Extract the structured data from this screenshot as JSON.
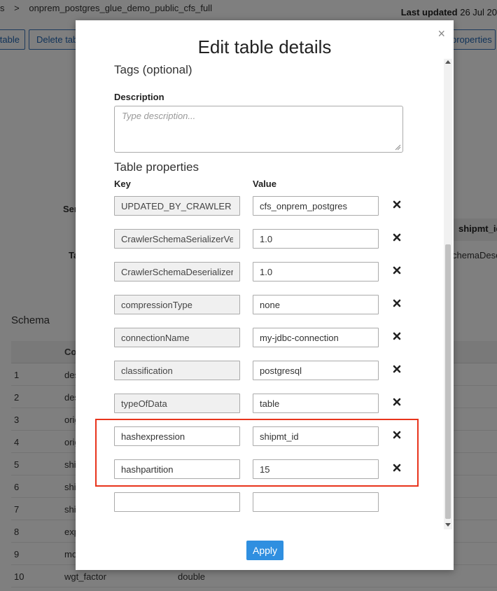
{
  "background": {
    "breadcrumb": {
      "separator": ">",
      "name": "onprem_postgres_glue_demo_public_cfs_full",
      "prefix": "s"
    },
    "last_updated": {
      "label": "Last updated",
      "value": "26 Jul 20"
    },
    "buttons": {
      "edit_table": "table",
      "delete_table": "Delete tab",
      "edit_properties": "properties"
    },
    "labels": {
      "serde": "Ser",
      "table": "Ta",
      "shipmt_header": "shipmt_id",
      "serde_value": "chemaDese"
    },
    "schema": {
      "title": "Schema",
      "column_header": "Co",
      "rows": [
        {
          "index": "1",
          "column": "des",
          "type": ""
        },
        {
          "index": "2",
          "column": "des",
          "type": ""
        },
        {
          "index": "3",
          "column": "orig",
          "type": ""
        },
        {
          "index": "4",
          "column": "orig",
          "type": ""
        },
        {
          "index": "5",
          "column": "shi",
          "type": ""
        },
        {
          "index": "6",
          "column": "shi",
          "type": ""
        },
        {
          "index": "7",
          "column": "shi",
          "type": ""
        },
        {
          "index": "8",
          "column": "exp",
          "type": ""
        },
        {
          "index": "9",
          "column": "mo",
          "type": ""
        },
        {
          "index": "10",
          "column": "wgt_factor",
          "type": "double"
        }
      ]
    }
  },
  "modal": {
    "title": "Edit table details",
    "close_symbol": "×",
    "tags_label": "Tags (optional)",
    "description_label": "Description",
    "description_placeholder": "Type description...",
    "table_properties_label": "Table properties",
    "key_header": "Key",
    "value_header": "Value",
    "properties": [
      {
        "key": "UPDATED_BY_CRAWLER",
        "value": "cfs_onprem_postgres",
        "readonly": true
      },
      {
        "key": "CrawlerSchemaSerializerVer",
        "value": "1.0",
        "readonly": true
      },
      {
        "key": "CrawlerSchemaDeserializerV",
        "value": "1.0",
        "readonly": true
      },
      {
        "key": "compressionType",
        "value": "none",
        "readonly": true
      },
      {
        "key": "connectionName",
        "value": "my-jdbc-connection",
        "readonly": true
      },
      {
        "key": "classification",
        "value": "postgresql",
        "readonly": true
      },
      {
        "key": "typeOfData",
        "value": "table",
        "readonly": true
      },
      {
        "key": "hashexpression",
        "value": "shipmt_id",
        "readonly": false
      },
      {
        "key": "hashpartition",
        "value": "15",
        "readonly": false
      }
    ],
    "new_property": {
      "key": "",
      "value": ""
    },
    "apply_label": "Apply"
  },
  "colors": {
    "primary": "#2f8fe0",
    "highlight": "#e8341c",
    "link": "#2366b3"
  },
  "icons": {
    "delete": "x-icon",
    "close": "close-icon"
  }
}
